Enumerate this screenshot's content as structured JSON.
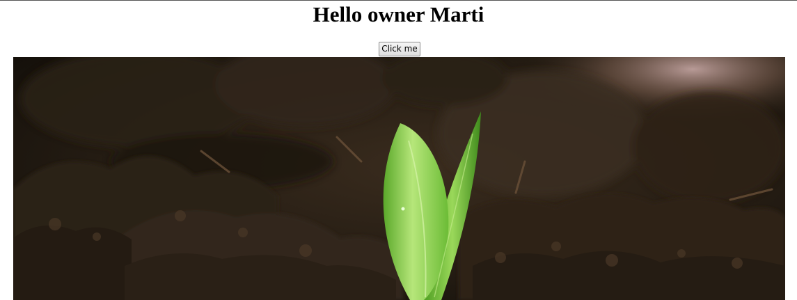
{
  "page": {
    "heading": "Hello owner Marti",
    "button_label": "Click me"
  },
  "image": {
    "subject": "plant-sprout-in-soil",
    "colors": {
      "soil_dark": "#1c1710",
      "soil_mid": "#3a2c1e",
      "soil_light": "#5a4431",
      "leaf_light": "#b6e67a",
      "leaf_mid": "#7cc83e",
      "leaf_dark": "#3f8a1c"
    }
  }
}
